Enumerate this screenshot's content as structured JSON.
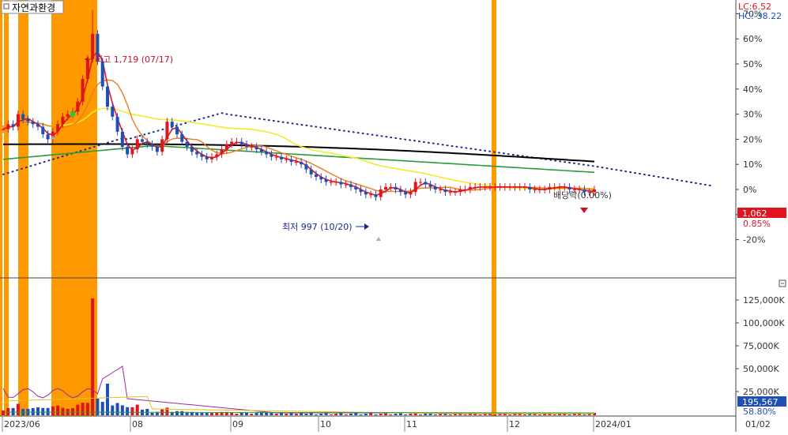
{
  "title": "자연과환경",
  "lc_label": "LC:6.52",
  "hc_label": "HC:-38.22",
  "colors": {
    "up": "#e0141e",
    "down": "#1f4fb4",
    "highlight": "#ff9900",
    "ma_fast": "#e0141e",
    "ma_mid": "#f07a1a",
    "ma_yellow": "#f2ea2a",
    "ma_green": "#2a9a3a",
    "ma_long": "#000000",
    "envelope": "#1a2a8c",
    "current_price_box": "#e0141e",
    "volume_box": "#1f4fb4"
  },
  "chart_data": {
    "type": "candlestick",
    "price_axis": {
      "unit": "%",
      "ticks": [
        "70%",
        "60%",
        "50%",
        "40%",
        "30%",
        "20%",
        "10%",
        "0%",
        "-10%",
        "-20%"
      ]
    },
    "volume_axis": {
      "ticks": [
        "125,000K",
        "100,000K",
        "75,000K",
        "50,000K",
        "25,000K"
      ],
      "current_volume": "195,567",
      "current_pct": "58.80%"
    },
    "x_axis": {
      "labels": [
        "2023/06",
        "08",
        "09",
        "10",
        "11",
        "12",
        "2024/01",
        "01/02"
      ]
    },
    "current_price": "1,062",
    "current_change": "0.85%",
    "annotations": {
      "high": "최고 1,719 (07/17)",
      "low": "최저 997 (10/20)",
      "dividend": "배당락(0.00%)"
    },
    "close_series_pct": [
      24,
      26,
      25,
      30,
      28,
      27,
      26,
      25,
      22,
      20,
      23,
      26,
      29,
      30,
      31,
      35,
      44,
      52,
      62,
      51,
      41,
      33,
      29,
      23,
      17,
      14,
      16,
      20,
      19,
      18,
      17,
      15,
      20,
      27,
      25,
      22,
      19,
      17,
      15,
      14,
      13,
      12,
      13,
      14,
      16,
      18,
      19,
      19,
      18,
      17,
      17,
      16,
      15,
      14,
      13,
      13,
      12,
      12,
      11,
      11,
      10,
      8,
      6,
      5,
      4,
      3,
      3,
      3,
      2,
      2,
      1,
      0,
      -1,
      -2,
      -2,
      -3,
      0,
      1,
      1,
      0,
      -1,
      -2,
      -1,
      3,
      3,
      2,
      1,
      0,
      0,
      -1,
      -1,
      -1,
      0,
      0,
      1,
      1,
      1,
      1,
      1,
      1,
      1,
      1,
      1,
      1,
      1,
      1,
      0,
      0,
      0,
      0,
      1,
      1,
      1,
      1,
      0,
      0,
      0,
      -1,
      -1,
      0
    ]
  }
}
